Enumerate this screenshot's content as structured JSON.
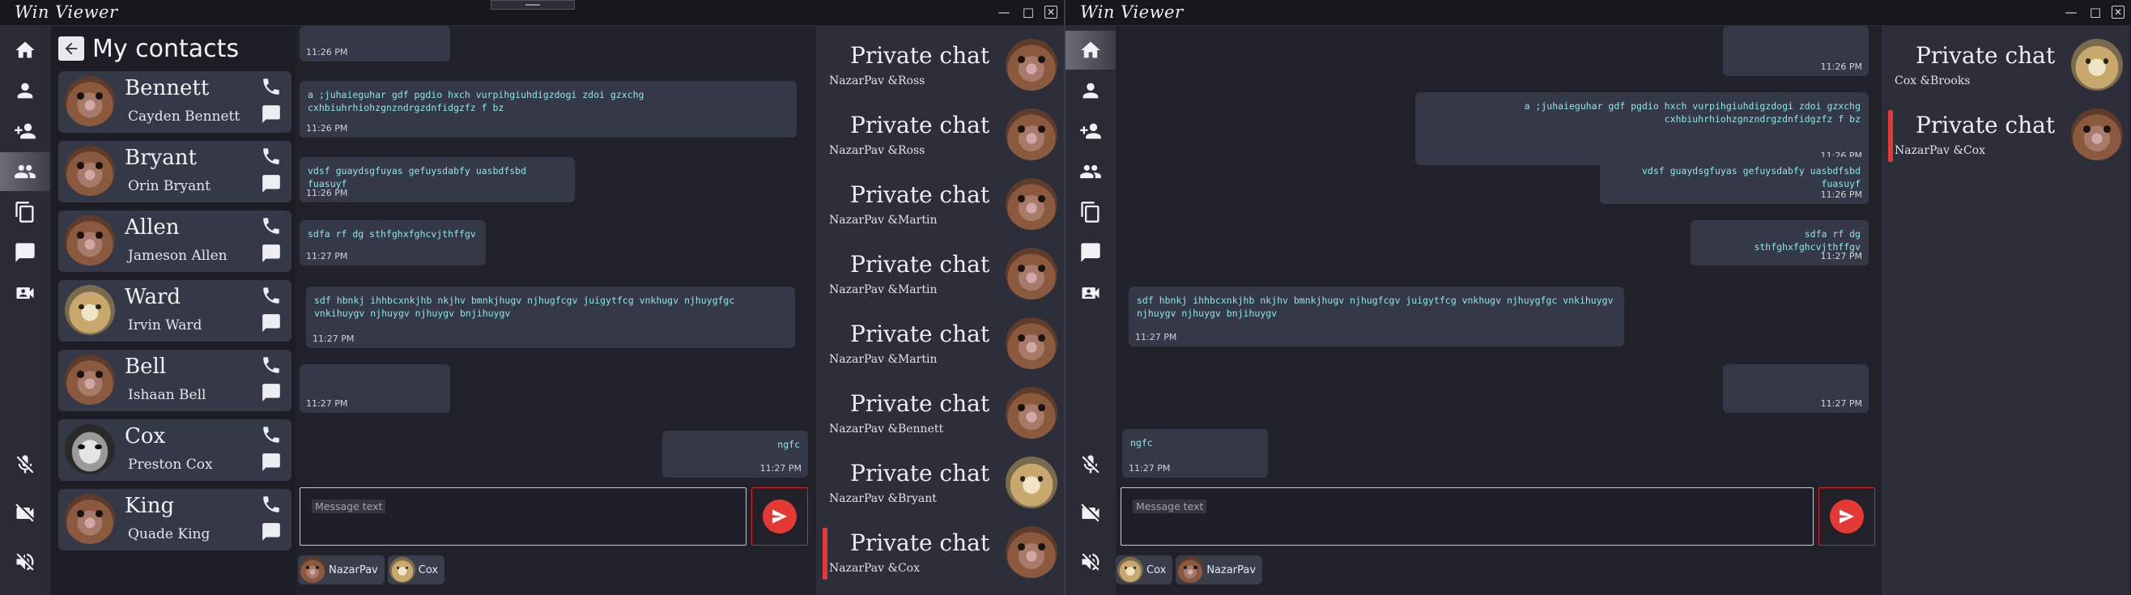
{
  "windows": [
    {
      "title": "Win Viewer",
      "contacts_title": "My contacts",
      "contacts": [
        {
          "name": "Bennett",
          "full": "Cayden Bennett",
          "avatar": "hamster"
        },
        {
          "name": "Bryant",
          "full": "Orin Bryant",
          "avatar": "hamster"
        },
        {
          "name": "Allen",
          "full": "Jameson Allen",
          "avatar": "hamster"
        },
        {
          "name": "Ward",
          "full": "Irvin Ward",
          "avatar": "cat"
        },
        {
          "name": "Bell",
          "full": "Ishaan Bell",
          "avatar": "hamster"
        },
        {
          "name": "Cox",
          "full": "Preston Cox",
          "avatar": "cox"
        },
        {
          "name": "King",
          "full": "Quade King",
          "avatar": "hamster"
        }
      ],
      "messages": [
        {
          "text": "",
          "time": "11:26 PM",
          "side": "left"
        },
        {
          "text": "a ;juhaieguhar gdf pgdio hxch vurpihgiuhdigzdogi zdoi gzxchg cxhbiuhrhiohzgnzndrgzdnfidgzfz f bz",
          "time": "11:26 PM",
          "side": "left"
        },
        {
          "text": "vdsf guaydsgfuyas gefuysdabfy uasbdfsbd fuasuyf",
          "time": "11:26 PM",
          "side": "left"
        },
        {
          "text": "sdfa rf dg sthfghxfghcvjthffgv",
          "time": "11:27 PM",
          "side": "left"
        },
        {
          "text": "sdf hbnkj ihhbcxnkjhb nkjhv bmnkjhugv njhugfcgv juigytfcg vnkhugv njhuygfgc vnkihuygv njhuygv njhuygv bnjihuygv",
          "time": "11:27 PM",
          "side": "left"
        },
        {
          "text": "",
          "time": "11:27 PM",
          "side": "left"
        },
        {
          "text": "ngfc",
          "time": "11:27 PM",
          "side": "right"
        }
      ],
      "placeholder": "Message text",
      "chips": [
        {
          "label": "NazarPav",
          "avatar": "hamster"
        },
        {
          "label": "Cox",
          "avatar": "cat"
        }
      ],
      "chats": [
        {
          "name": "Private chat",
          "pair": "NazarPav &Ross",
          "avatar": "hamster"
        },
        {
          "name": "Private chat",
          "pair": "NazarPav &Ross",
          "avatar": "hamster"
        },
        {
          "name": "Private chat",
          "pair": "NazarPav &Martin",
          "avatar": "hamster"
        },
        {
          "name": "Private chat",
          "pair": "NazarPav &Martin",
          "avatar": "hamster"
        },
        {
          "name": "Private chat",
          "pair": "NazarPav &Martin",
          "avatar": "hamster"
        },
        {
          "name": "Private chat",
          "pair": "NazarPav &Bennett",
          "avatar": "hamster"
        },
        {
          "name": "Private chat",
          "pair": "NazarPav &Bryant",
          "avatar": "cat"
        },
        {
          "name": "Private chat",
          "pair": "NazarPav &Cox",
          "avatar": "hamster",
          "selected": true
        }
      ]
    },
    {
      "title": "Win Viewer",
      "messages": [
        {
          "text": "",
          "time": "11:26 PM",
          "side": "right"
        },
        {
          "text": "a ;juhaieguhar gdf pgdio hxch vurpihgiuhdigzdogi zdoi gzxchg cxhbiuhrhiohzgnzndrgzdnfidgzfz f bz",
          "time": "11:26 PM",
          "side": "right"
        },
        {
          "text": "vdsf guaydsgfuyas gefuysdabfy uasbdfsbd fuasuyf",
          "time": "11:26 PM",
          "side": "right"
        },
        {
          "text": "sdfa rf dg sthfghxfghcvjthffgv",
          "time": "11:27 PM",
          "side": "right"
        },
        {
          "text": "sdf hbnkj ihhbcxnkjhb nkjhv bmnkjhugv njhugfcgv juigytfcg vnkhugv njhuygfgc vnkihuygv njhuygv njhuygv bnjihuygv",
          "time": "11:27 PM",
          "side": "left"
        },
        {
          "text": "",
          "time": "11:27 PM",
          "side": "right"
        },
        {
          "text": "ngfc",
          "time": "11:27 PM",
          "side": "left"
        }
      ],
      "placeholder": "Message text",
      "chips": [
        {
          "label": "Cox",
          "avatar": "cat"
        },
        {
          "label": "NazarPav",
          "avatar": "hamster"
        }
      ],
      "chats": [
        {
          "name": "Private chat",
          "pair": "Cox &Brooks",
          "avatar": "cat"
        },
        {
          "name": "Private chat",
          "pair": "NazarPav &Cox",
          "avatar": "hamster",
          "selected": true
        }
      ]
    }
  ],
  "colors": {
    "accent": "#e53935",
    "panel": "#353846",
    "message_text": "#8fe6e8"
  }
}
